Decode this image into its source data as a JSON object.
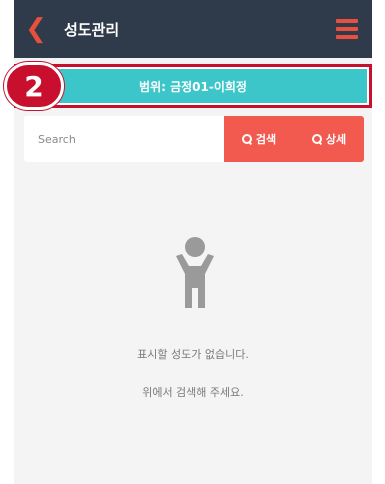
{
  "header": {
    "back_icon": "chevron-left-icon",
    "title": "성도관리",
    "menu_icon": "hamburger-menu-icon"
  },
  "scope": {
    "text": "범위: 금정01-이희정"
  },
  "step_badge": {
    "number": "2"
  },
  "search": {
    "placeholder": "Search",
    "value": "",
    "search_button": "검색",
    "detail_button": "상세"
  },
  "empty_state": {
    "icon": "person-raised-arms-icon",
    "line1": "표시할 성도가 없습니다.",
    "line2": "위에서 검색해 주세요."
  },
  "colors": {
    "header_bg": "#2f3a4a",
    "accent_red": "#e8503e",
    "scope_teal": "#3cc6c9",
    "button_coral": "#f25a50",
    "highlight_red": "#c8102e"
  }
}
